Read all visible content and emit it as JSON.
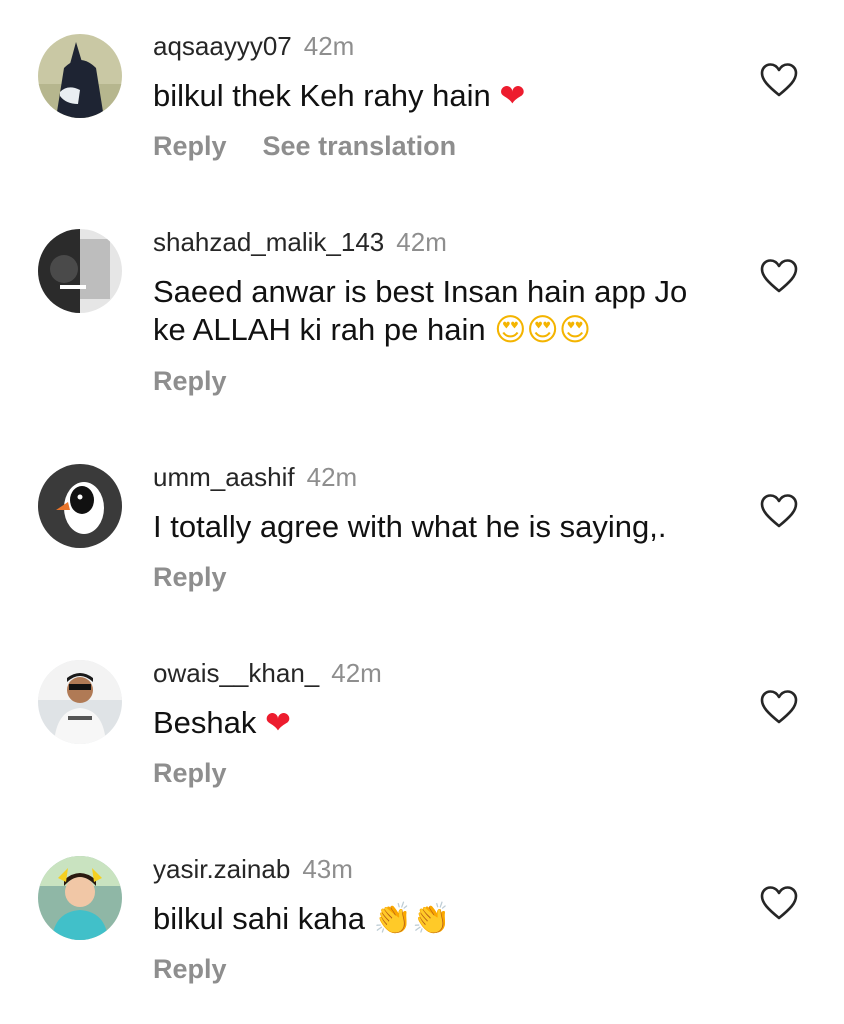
{
  "comments": [
    {
      "username": "aqsaayyy07",
      "time": "42m",
      "text": "bilkul thek Keh rahy hain",
      "emoji": "❤",
      "reply": "Reply",
      "see_translation": "See translation"
    },
    {
      "username": "shahzad_malik_143",
      "time": "42m",
      "text_line1": "Saeed anwar is best Insan hain app Jo",
      "text_line2": "ke ALLAH ki rah pe hain",
      "emoji": "😍😍😍",
      "reply": "Reply"
    },
    {
      "username": "umm_aashif",
      "time": "42m",
      "text": "I totally agree with what he is saying,.",
      "reply": "Reply"
    },
    {
      "username": "owais__khan_",
      "time": "42m",
      "text": "Beshak",
      "emoji": "❤",
      "reply": "Reply"
    },
    {
      "username": "yasir.zainab",
      "time": "43m",
      "text": "bilkul sahi kaha",
      "emoji": "👏👏",
      "reply": "Reply"
    }
  ],
  "icons": {
    "like": "heart-outline-icon"
  },
  "colors": {
    "username": "#262626",
    "muted": "#8e8e8e",
    "heart": "#ed1c2e"
  }
}
